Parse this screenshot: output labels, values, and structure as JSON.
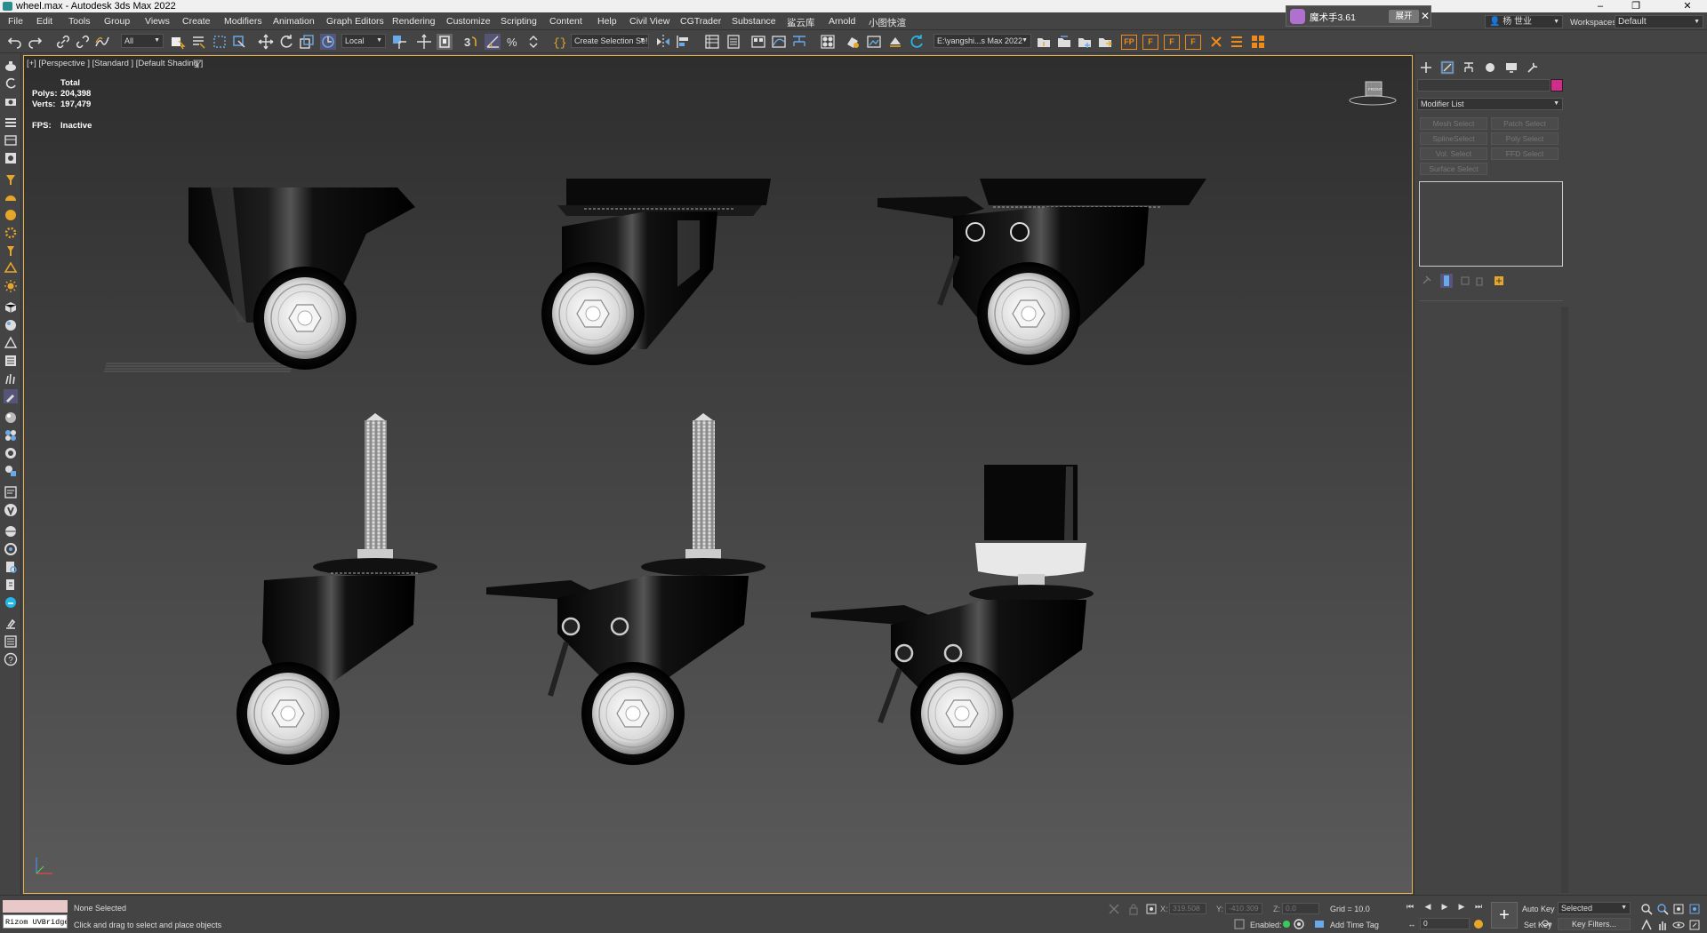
{
  "window": {
    "title": "wheel.max - Autodesk 3ds Max 2022",
    "min_label": "–",
    "restore_label": "❐",
    "close_label": "✕"
  },
  "menu": [
    "File",
    "Edit",
    "Tools",
    "Group",
    "Views",
    "Create",
    "Modifiers",
    "Animation",
    "Graph Editors",
    "Rendering",
    "Customize",
    "Scripting",
    "Content",
    "Help",
    "Civil View",
    "CGTrader",
    "Substance",
    "鲨云库",
    "Arnold",
    "小图快渲"
  ],
  "plugin": {
    "label": "魔术手3.61",
    "button": "展开",
    "close": "✕"
  },
  "user": {
    "name": "杨 世业"
  },
  "workspace": {
    "label": "Workspaces:",
    "value": "Default"
  },
  "toolbar": {
    "filter": "All",
    "coord_system": "Local",
    "selection_set": "Create Selection Se!",
    "project_path": "E:\\yangshi...s Max 2022",
    "fp_buttons": [
      "FP",
      "F",
      "F",
      "F"
    ]
  },
  "viewport": {
    "label": "[+] [Perspective ] [Standard ] [Default Shading ]",
    "stats_header": "Total",
    "polys_label": "Polys:",
    "polys_value": "204,398",
    "verts_label": "Verts:",
    "verts_value": "197,479",
    "fps_label": "FPS:",
    "fps_value": "Inactive",
    "viewcube_label": "FRONT"
  },
  "command_panel": {
    "modifier_list": "Modifier List",
    "modifier_buttons": [
      "Mesh Select",
      "Patch Select",
      "SplineSelect",
      "Poly Select",
      "Vol. Select",
      "FFD Select",
      "Surface Select"
    ],
    "object_color": "#d32b8a"
  },
  "status": {
    "listener_text": "Rizom UVBridge_",
    "selection": "None Selected",
    "prompt": "Click and drag to select and place objects",
    "x_label": "X:",
    "x_value": "319.508",
    "y_label": "Y:",
    "y_value": "-410.309",
    "z_label": "Z:",
    "z_value": "0.0",
    "grid": "Grid = 10.0",
    "enabled": "Enabled:",
    "add_time_tag": "Add Time Tag",
    "auto_key": "Auto Key",
    "set_key": "Set Key",
    "selected_dd": "Selected",
    "key_filters": "Key Filters...",
    "frame": "0"
  }
}
